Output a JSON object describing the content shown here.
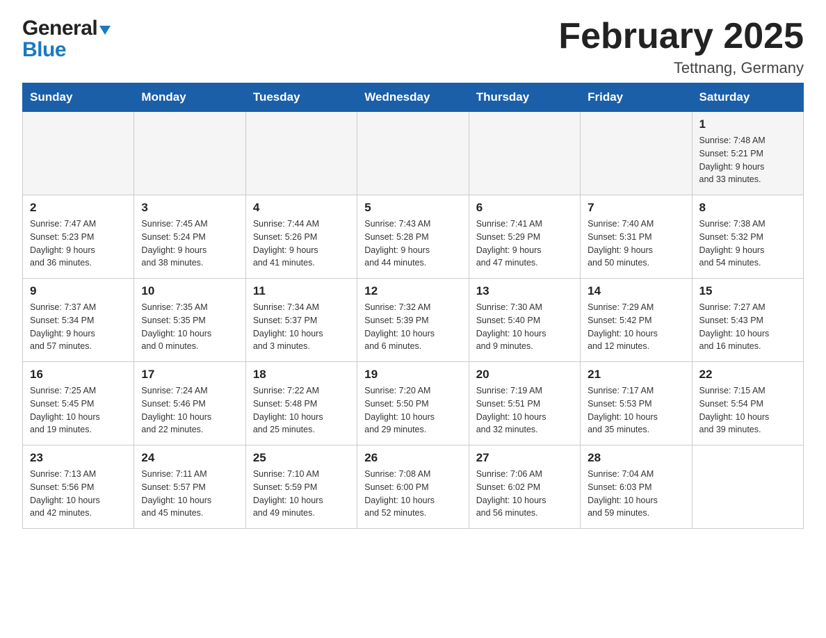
{
  "header": {
    "logo_general": "General",
    "logo_triangle": "▶",
    "logo_blue": "Blue",
    "title": "February 2025",
    "subtitle": "Tettnang, Germany"
  },
  "days_of_week": [
    "Sunday",
    "Monday",
    "Tuesday",
    "Wednesday",
    "Thursday",
    "Friday",
    "Saturday"
  ],
  "weeks": [
    [
      {
        "day": "",
        "info": ""
      },
      {
        "day": "",
        "info": ""
      },
      {
        "day": "",
        "info": ""
      },
      {
        "day": "",
        "info": ""
      },
      {
        "day": "",
        "info": ""
      },
      {
        "day": "",
        "info": ""
      },
      {
        "day": "1",
        "info": "Sunrise: 7:48 AM\nSunset: 5:21 PM\nDaylight: 9 hours\nand 33 minutes."
      }
    ],
    [
      {
        "day": "2",
        "info": "Sunrise: 7:47 AM\nSunset: 5:23 PM\nDaylight: 9 hours\nand 36 minutes."
      },
      {
        "day": "3",
        "info": "Sunrise: 7:45 AM\nSunset: 5:24 PM\nDaylight: 9 hours\nand 38 minutes."
      },
      {
        "day": "4",
        "info": "Sunrise: 7:44 AM\nSunset: 5:26 PM\nDaylight: 9 hours\nand 41 minutes."
      },
      {
        "day": "5",
        "info": "Sunrise: 7:43 AM\nSunset: 5:28 PM\nDaylight: 9 hours\nand 44 minutes."
      },
      {
        "day": "6",
        "info": "Sunrise: 7:41 AM\nSunset: 5:29 PM\nDaylight: 9 hours\nand 47 minutes."
      },
      {
        "day": "7",
        "info": "Sunrise: 7:40 AM\nSunset: 5:31 PM\nDaylight: 9 hours\nand 50 minutes."
      },
      {
        "day": "8",
        "info": "Sunrise: 7:38 AM\nSunset: 5:32 PM\nDaylight: 9 hours\nand 54 minutes."
      }
    ],
    [
      {
        "day": "9",
        "info": "Sunrise: 7:37 AM\nSunset: 5:34 PM\nDaylight: 9 hours\nand 57 minutes."
      },
      {
        "day": "10",
        "info": "Sunrise: 7:35 AM\nSunset: 5:35 PM\nDaylight: 10 hours\nand 0 minutes."
      },
      {
        "day": "11",
        "info": "Sunrise: 7:34 AM\nSunset: 5:37 PM\nDaylight: 10 hours\nand 3 minutes."
      },
      {
        "day": "12",
        "info": "Sunrise: 7:32 AM\nSunset: 5:39 PM\nDaylight: 10 hours\nand 6 minutes."
      },
      {
        "day": "13",
        "info": "Sunrise: 7:30 AM\nSunset: 5:40 PM\nDaylight: 10 hours\nand 9 minutes."
      },
      {
        "day": "14",
        "info": "Sunrise: 7:29 AM\nSunset: 5:42 PM\nDaylight: 10 hours\nand 12 minutes."
      },
      {
        "day": "15",
        "info": "Sunrise: 7:27 AM\nSunset: 5:43 PM\nDaylight: 10 hours\nand 16 minutes."
      }
    ],
    [
      {
        "day": "16",
        "info": "Sunrise: 7:25 AM\nSunset: 5:45 PM\nDaylight: 10 hours\nand 19 minutes."
      },
      {
        "day": "17",
        "info": "Sunrise: 7:24 AM\nSunset: 5:46 PM\nDaylight: 10 hours\nand 22 minutes."
      },
      {
        "day": "18",
        "info": "Sunrise: 7:22 AM\nSunset: 5:48 PM\nDaylight: 10 hours\nand 25 minutes."
      },
      {
        "day": "19",
        "info": "Sunrise: 7:20 AM\nSunset: 5:50 PM\nDaylight: 10 hours\nand 29 minutes."
      },
      {
        "day": "20",
        "info": "Sunrise: 7:19 AM\nSunset: 5:51 PM\nDaylight: 10 hours\nand 32 minutes."
      },
      {
        "day": "21",
        "info": "Sunrise: 7:17 AM\nSunset: 5:53 PM\nDaylight: 10 hours\nand 35 minutes."
      },
      {
        "day": "22",
        "info": "Sunrise: 7:15 AM\nSunset: 5:54 PM\nDaylight: 10 hours\nand 39 minutes."
      }
    ],
    [
      {
        "day": "23",
        "info": "Sunrise: 7:13 AM\nSunset: 5:56 PM\nDaylight: 10 hours\nand 42 minutes."
      },
      {
        "day": "24",
        "info": "Sunrise: 7:11 AM\nSunset: 5:57 PM\nDaylight: 10 hours\nand 45 minutes."
      },
      {
        "day": "25",
        "info": "Sunrise: 7:10 AM\nSunset: 5:59 PM\nDaylight: 10 hours\nand 49 minutes."
      },
      {
        "day": "26",
        "info": "Sunrise: 7:08 AM\nSunset: 6:00 PM\nDaylight: 10 hours\nand 52 minutes."
      },
      {
        "day": "27",
        "info": "Sunrise: 7:06 AM\nSunset: 6:02 PM\nDaylight: 10 hours\nand 56 minutes."
      },
      {
        "day": "28",
        "info": "Sunrise: 7:04 AM\nSunset: 6:03 PM\nDaylight: 10 hours\nand 59 minutes."
      },
      {
        "day": "",
        "info": ""
      }
    ]
  ]
}
